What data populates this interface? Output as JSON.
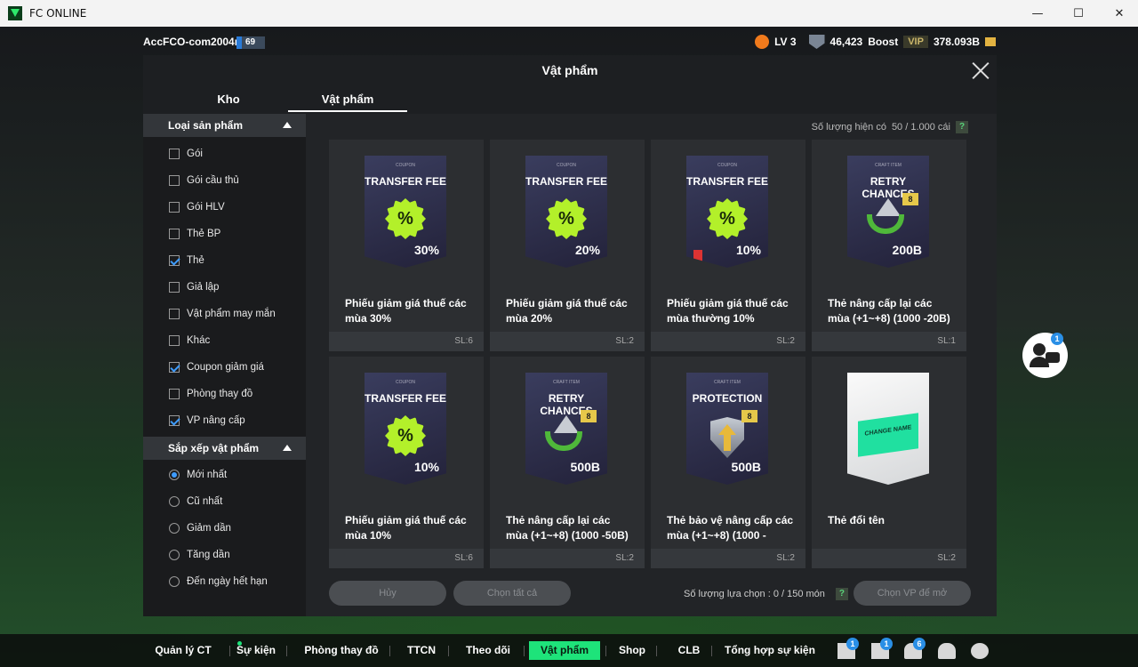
{
  "window": {
    "title": "FC ONLINE",
    "controls": [
      "—",
      "☐",
      "✕"
    ]
  },
  "topbar": {
    "account": "AccFCO-com2004m",
    "level_badge": "69",
    "lv": "LV 3",
    "points": "46,423",
    "boost": "Boost",
    "vip": "VIP",
    "balance": "378.093B"
  },
  "modal": {
    "title": "Vật phẩm",
    "tabs": [
      "Kho",
      "Vật phẩm"
    ],
    "count_label": "Số lượng hiện có",
    "count_value": "50 / 1.000 cái",
    "help": "?"
  },
  "sidebar": {
    "section1": "Loại sản phẩm",
    "filters": [
      {
        "label": "Gói",
        "checked": false
      },
      {
        "label": "Gói cầu thủ",
        "checked": false
      },
      {
        "label": "Gói HLV",
        "checked": false
      },
      {
        "label": "Thẻ BP",
        "checked": false
      },
      {
        "label": "Thẻ",
        "checked": true
      },
      {
        "label": "Giả lập",
        "checked": false
      },
      {
        "label": "Vật phẩm may mắn",
        "checked": false
      },
      {
        "label": "Khác",
        "checked": false
      },
      {
        "label": "Coupon giảm giá",
        "checked": true
      },
      {
        "label": "Phòng thay đồ",
        "checked": false
      },
      {
        "label": "VP nâng cấp",
        "checked": true
      }
    ],
    "section2": "Sắp xếp vật phẩm",
    "sorts": [
      {
        "label": "Mới nhất",
        "selected": true
      },
      {
        "label": "Cũ nhất",
        "selected": false
      },
      {
        "label": "Giảm dần",
        "selected": false
      },
      {
        "label": "Tăng dần",
        "selected": false
      },
      {
        "label": "Đến ngày hết hạn",
        "selected": false
      }
    ]
  },
  "items": [
    {
      "kind": "coupon",
      "small": "COUPON",
      "big": "TRANSFER FEE",
      "mark": "30%",
      "name": "Phiếu giảm giá thuế các mùa 30%",
      "qty": "SL:6"
    },
    {
      "kind": "coupon",
      "small": "COUPON",
      "big": "TRANSFER FEE",
      "mark": "20%",
      "name": "Phiếu giảm giá thuế các mùa 20%",
      "qty": "SL:2"
    },
    {
      "kind": "coupon",
      "small": "COUPON",
      "big": "TRANSFER FEE",
      "mark": "10%",
      "name": "Phiếu giảm giá thuế các mùa thường 10%",
      "qty": "SL:2"
    },
    {
      "kind": "retry",
      "small": "CRAFT ITEM",
      "big": "RETRY CHANCES",
      "mark": "200B",
      "name": "Thẻ nâng cấp lại các mùa (+1~+8) (1000 -20B)",
      "qty": "SL:1"
    },
    {
      "kind": "coupon",
      "small": "COUPON",
      "big": "TRANSFER FEE",
      "mark": "10%",
      "name": "Phiếu giảm giá thuế các mùa 10%",
      "qty": "SL:6"
    },
    {
      "kind": "retry",
      "small": "CRAFT ITEM",
      "big": "RETRY CHANCES",
      "mark": "500B",
      "name": "Thẻ nâng cấp lại các mùa (+1~+8) (1000 -50B)",
      "qty": "SL:2"
    },
    {
      "kind": "protect",
      "small": "CRAFT ITEM",
      "big": "PROTECTION",
      "mark": "500B",
      "name": "Thẻ bảo vệ nâng cấp các mùa (+1~+8) (1000 -",
      "qty": "SL:2"
    },
    {
      "kind": "rename",
      "small": "",
      "big": "",
      "mark": "CHANGE NAME",
      "name": "Thẻ đổi tên",
      "qty": "SL:2"
    }
  ],
  "footer": {
    "cancel": "Hủy",
    "select_all": "Chọn tất cả",
    "selected_label": "Số lượng lựa chọn : 0 / 150 món",
    "help": "?",
    "pick": "Chọn VP để mở"
  },
  "chat_badge": "1",
  "bottomnav": {
    "items": [
      "Quản lý CT",
      "Sự kiện",
      "Phòng thay đồ",
      "TTCN",
      "Theo dõi",
      "Vật phẩm",
      "Shop",
      "CLB",
      "Tổng hợp sự kiện"
    ],
    "active": "Vật phẩm",
    "badges": [
      "1",
      "1",
      "6"
    ]
  }
}
